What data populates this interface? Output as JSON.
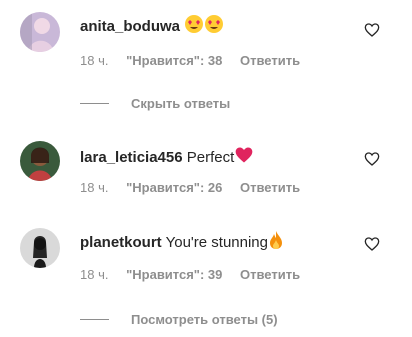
{
  "comments": [
    {
      "username": "anita_boduwa",
      "text": "",
      "emoji": [
        "heart-eyes-emoji",
        "heart-eyes-emoji"
      ],
      "time": "18 ч.",
      "likes": "\"Нравится\": 38",
      "reply": "Ответить"
    },
    {
      "username": "lara_leticia456",
      "text": "Perfect",
      "emoji": [
        "red-heart-emoji"
      ],
      "time": "18 ч.",
      "likes": "\"Нравится\": 26",
      "reply": "Ответить"
    },
    {
      "username": "planetkourt",
      "text": "You're stunning",
      "emoji": [
        "fire-emoji"
      ],
      "time": "18 ч.",
      "likes": "\"Нравится\": 39",
      "reply": "Ответить"
    }
  ],
  "thread_toggles": {
    "hide_replies": "Скрыть ответы",
    "view_replies": "Посмотреть ответы (5)"
  },
  "colors": {
    "text": "#262626",
    "secondary": "#8e8e8e",
    "heart_red": "#e0245e"
  }
}
